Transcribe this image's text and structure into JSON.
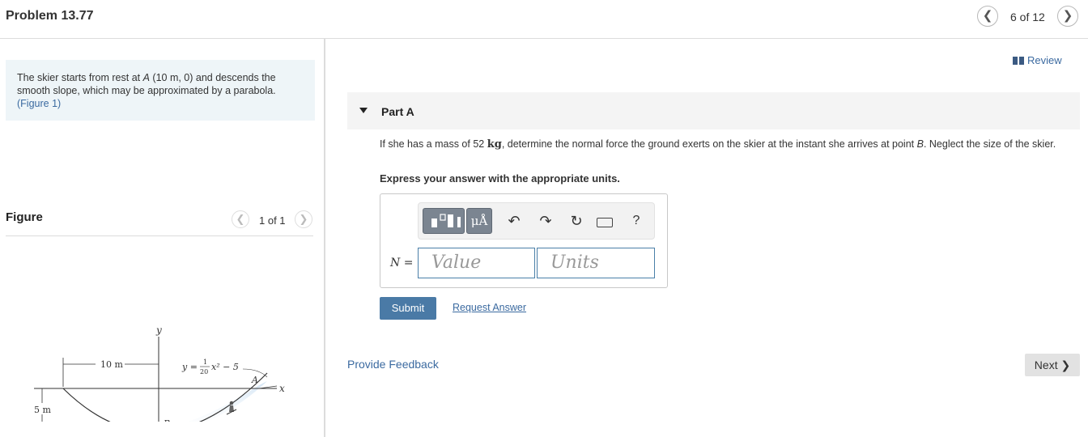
{
  "header": {
    "title": "Problem 13.77",
    "counter": "6 of 12",
    "prev_icon": "chevron-left-icon",
    "next_icon": "chevron-right-icon"
  },
  "intro": {
    "text_before": "The skier starts from rest at ",
    "point": "A",
    "coords": " (10 m, 0) and descends the smooth slope, which may be approximated by a parabola.",
    "figure_link": "(Figure 1)"
  },
  "figure": {
    "label": "Figure",
    "counter": "1 of 1",
    "diagram_labels": {
      "y_axis": "y",
      "x_axis": "x",
      "width_dim": "10 m",
      "height_dim": "5 m",
      "point_a": "A",
      "point_b": "B",
      "equation": "y = ",
      "eq_num": "1",
      "eq_den": "20",
      "eq_rest": "x² − 5"
    }
  },
  "review": {
    "label": "Review",
    "icon": "book-icon"
  },
  "part": {
    "title": "Part A",
    "question_before": "If she has a mass of 52 ",
    "question_unit": "kg",
    "question_mid": ", determine the normal force the ground exerts on the skier at the instant she arrives at point ",
    "question_point": "B",
    "question_after": ". Neglect the size of the skier.",
    "instructions": "Express your answer with the appropriate units."
  },
  "answer": {
    "var_name": "N",
    "equals": " =",
    "value_placeholder": "Value",
    "units_placeholder": "Units",
    "units_button": "μÅ",
    "help": "?"
  },
  "actions": {
    "submit": "Submit",
    "request_answer": "Request Answer",
    "provide_feedback": "Provide Feedback",
    "next": "Next ❯"
  }
}
